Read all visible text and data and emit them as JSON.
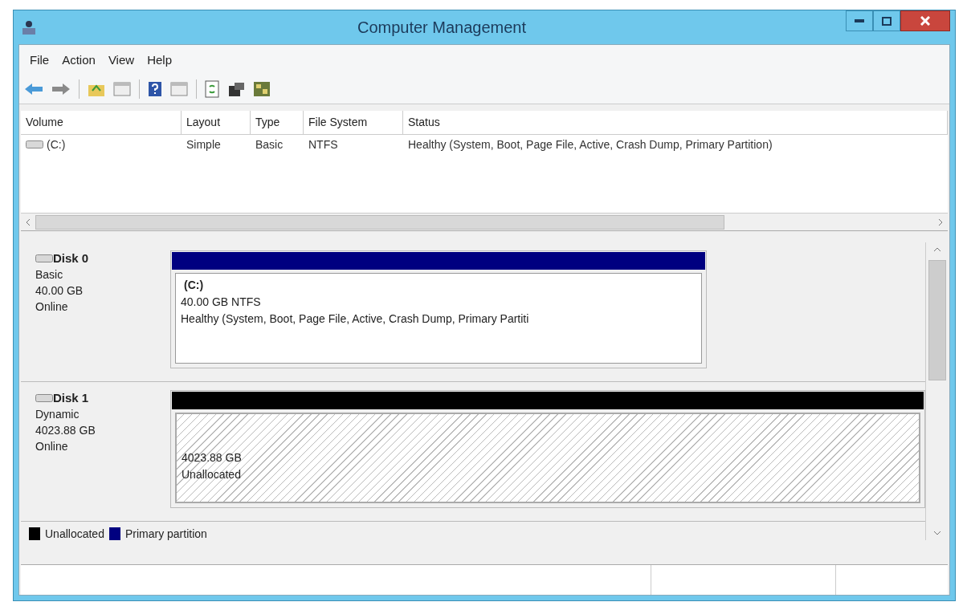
{
  "window": {
    "title": "Computer Management"
  },
  "menu": [
    "File",
    "Action",
    "View",
    "Help"
  ],
  "volume_table": {
    "columns": [
      "Volume",
      "Layout",
      "Type",
      "File System",
      "Status"
    ],
    "rows": [
      {
        "cells": [
          "(C:)",
          "Simple",
          "Basic",
          "NTFS",
          "Healthy (System, Boot, Page File, Active, Crash Dump, Primary Partition)"
        ]
      }
    ]
  },
  "disks": [
    {
      "name": "Disk 0",
      "type": "Basic",
      "size": "40.00 GB",
      "state": "Online",
      "partitions": [
        {
          "kind": "primary",
          "color": "#000080",
          "label": "(C:)",
          "size": "40.00 GB NTFS",
          "status": "Healthy (System, Boot, Page File, Active, Crash Dump, Primary Partiti"
        }
      ]
    },
    {
      "name": "Disk 1",
      "type": "Dynamic",
      "size": "4023.88 GB",
      "state": "Online",
      "partitions": [
        {
          "kind": "unallocated",
          "color": "#000000",
          "size": "4023.88 GB",
          "status": "Unallocated"
        }
      ]
    }
  ],
  "legend": [
    {
      "label": "Unallocated",
      "color": "#000000"
    },
    {
      "label": "Primary partition",
      "color": "#000080"
    }
  ]
}
